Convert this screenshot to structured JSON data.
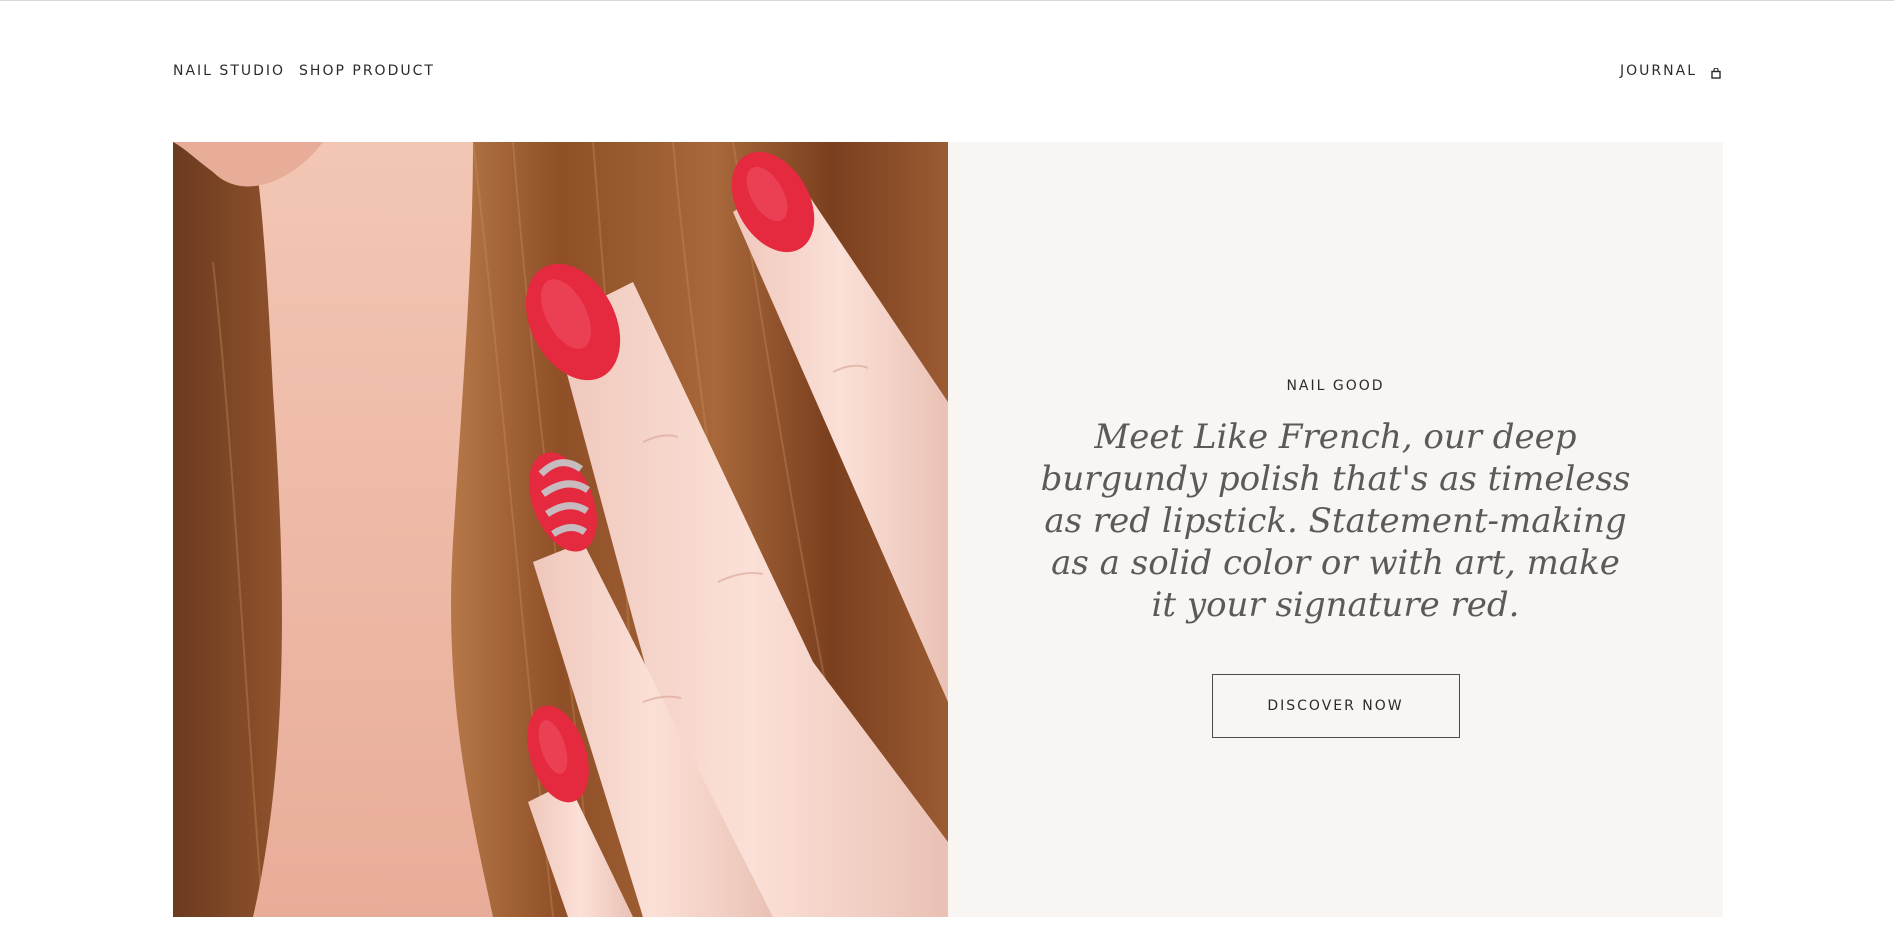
{
  "nav": {
    "left_links": [
      {
        "label": "NAIL STUDIO"
      },
      {
        "label": "SHOP PRODUCT"
      }
    ],
    "right_links": [
      {
        "label": "JOURNAL"
      }
    ],
    "cart_icon": "shopping-bag-icon"
  },
  "hero": {
    "eyebrow": "NAIL GOOD",
    "headline": "Meet Like French, our deep burgundy polish that's as timeless as red lipstick. Statement-making as a solid color or with art, make it your signature red.",
    "cta_label": "DISCOVER NOW",
    "panel_color": "#f8f5f3",
    "nail_color": "#e5293f"
  }
}
